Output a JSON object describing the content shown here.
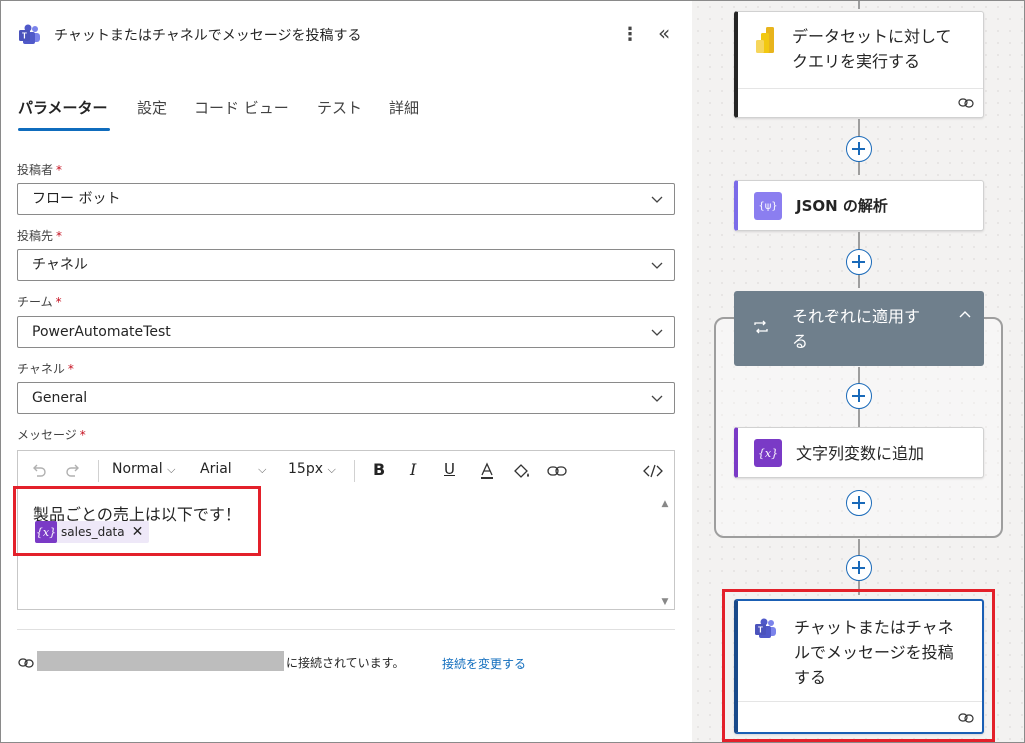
{
  "panel": {
    "title": "チャットまたはチャネルでメッセージを投稿する",
    "tabs": [
      "パラメーター",
      "設定",
      "コード ビュー",
      "テスト",
      "詳細"
    ],
    "active_tab": "パラメーター",
    "fields": [
      {
        "label": "投稿者",
        "value": "フロー ボット"
      },
      {
        "label": "投稿先",
        "value": "チャネル"
      },
      {
        "label": "チーム",
        "value": "PowerAutomateTest"
      },
      {
        "label": "チャネル",
        "value": "General"
      }
    ],
    "message": {
      "label": "メッセージ",
      "toolbar": {
        "style": "Normal",
        "font": "Arial",
        "size": "15px"
      },
      "text": "製品ごとの売上は以下です！",
      "token": "sales_data",
      "token_icon": "{x}"
    },
    "connection": {
      "text": "に接続されています。",
      "link": "接続を変更する"
    }
  },
  "canvas": {
    "card_query": "データセットに対して\nクエリを実行する",
    "card_json": "JSON の解析",
    "json_icon": "{ψ}",
    "foreach": "それぞれに適用す\nる",
    "card_append": "文字列変数に追加",
    "append_icon": "{x}",
    "card_teams": "チャットまたはチャネ\nルでメッセージを投稿\nする"
  },
  "colors": {
    "accent": "#0f6cbd",
    "highlight": "#e3202a",
    "variable": "#7a3ac6",
    "foreach": "#6f7f8c"
  }
}
